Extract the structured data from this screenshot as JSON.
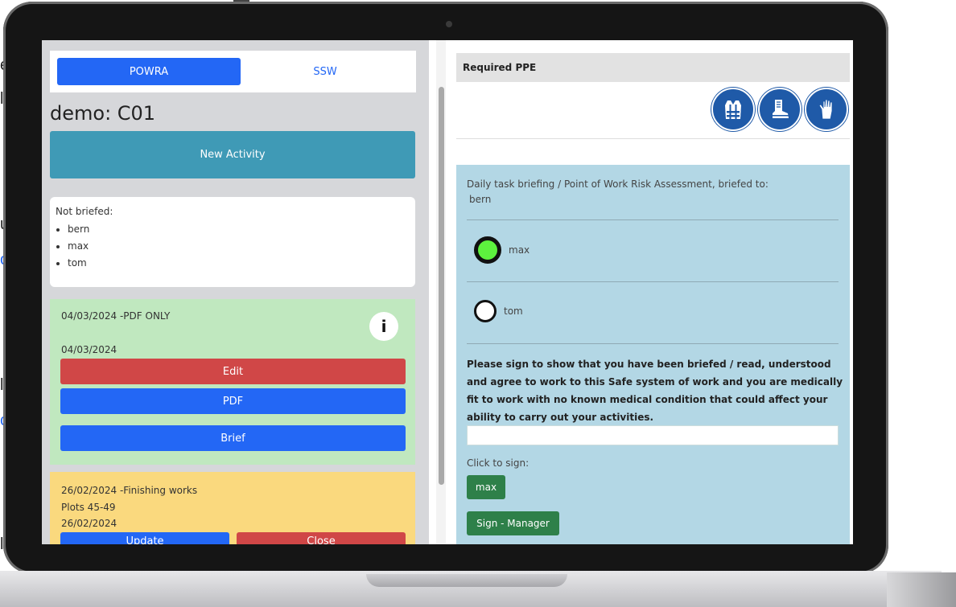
{
  "background_fragments": [
    "e",
    "l",
    "u",
    "o:",
    "l",
    "c",
    "l"
  ],
  "tabs": [
    {
      "label": "POWRA",
      "active": true
    },
    {
      "label": "SSW",
      "active": false
    }
  ],
  "site_title": "demo: C01",
  "new_activity_label": "New Activity",
  "not_briefed": {
    "title": "Not briefed:",
    "names": [
      "bern",
      "max",
      "tom"
    ]
  },
  "activities": [
    {
      "title": "04/03/2024 -PDF ONLY",
      "date": "04/03/2024",
      "info_label": "i",
      "color": "#c0e8bf",
      "buttons": {
        "edit": "Edit",
        "pdf": "PDF",
        "brief": "Brief"
      }
    },
    {
      "title": "26/02/2024 -Finishing works",
      "subtitle": "Plots 45-49",
      "date": "26/02/2024",
      "color": "#fad97e",
      "buttons": {
        "update": "Update",
        "close": "Close"
      }
    }
  ],
  "ppe": {
    "header": "Required PPE",
    "icons": [
      "hi-vis-vest-icon",
      "safety-boots-icon",
      "safety-gloves-icon"
    ]
  },
  "briefing": {
    "intro": "Daily task briefing / Point of Work Risk Assessment, briefed to:",
    "briefed_to": "bern",
    "people": [
      {
        "name": "max",
        "checked": true
      },
      {
        "name": "tom",
        "checked": false
      }
    ],
    "declaration": "Please sign to show that you have been briefed / read, understood and agree to work to this Safe system of work and you are medically fit to work with no known medical condition that could affect your ability to carry out your activities.",
    "signature_value": "",
    "click_to_sign": "Click to sign:",
    "sign_button": "max",
    "manager_button": "Sign - Manager"
  },
  "colors": {
    "primary": "#2367f5",
    "danger": "#d04747",
    "info": "#3f9ab6",
    "success": "#2e8049",
    "briefing_panel": "#b3d7e5",
    "ppe_icon": "#1f5aa8"
  }
}
